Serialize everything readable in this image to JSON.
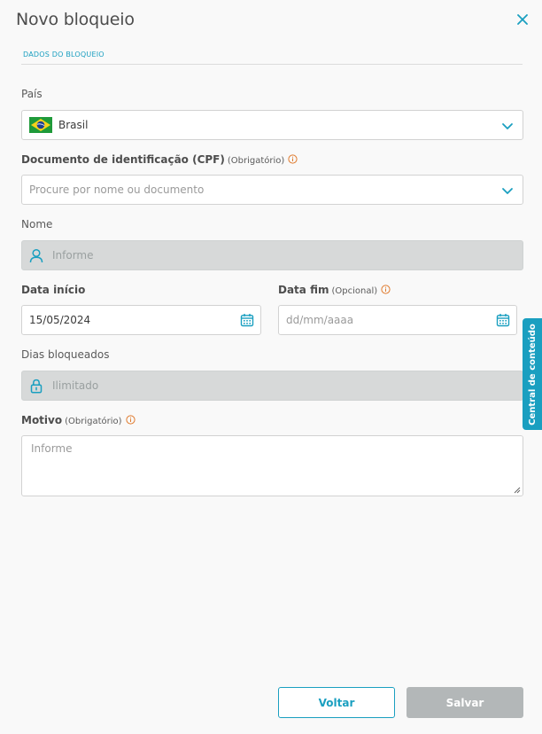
{
  "modal": {
    "title": "Novo bloqueio",
    "section": "DADOS DO BLOQUEIO"
  },
  "fields": {
    "country": {
      "label": "País",
      "value": "Brasil"
    },
    "document": {
      "label": "Documento de identificação (CPF)",
      "required": "(Obrigatório)",
      "placeholder": "Procure por nome ou documento"
    },
    "name": {
      "label": "Nome",
      "placeholder": "Informe"
    },
    "start_date": {
      "label": "Data início",
      "value": "15/05/2024"
    },
    "end_date": {
      "label": "Data fim",
      "optional": "(Opcional)",
      "placeholder": "dd/mm/aaaa"
    },
    "blocked_days": {
      "label": "Dias bloqueados",
      "value": "Ilimitado"
    },
    "reason": {
      "label": "Motivo",
      "required": "(Obrigatório)",
      "placeholder": "Informe"
    }
  },
  "side_tab": {
    "label": "Central de conteúdo"
  },
  "buttons": {
    "back": "Voltar",
    "save": "Salvar"
  },
  "colors": {
    "accent": "#1a9fc0",
    "info": "#e07b2e",
    "disabled": "#d7d9d9",
    "save_disabled": "#b3b7b8"
  },
  "icons": [
    "close-icon",
    "brazil-flag-icon",
    "chevron-down-icon",
    "info-icon",
    "user-icon",
    "calendar-icon",
    "lock-icon"
  ]
}
